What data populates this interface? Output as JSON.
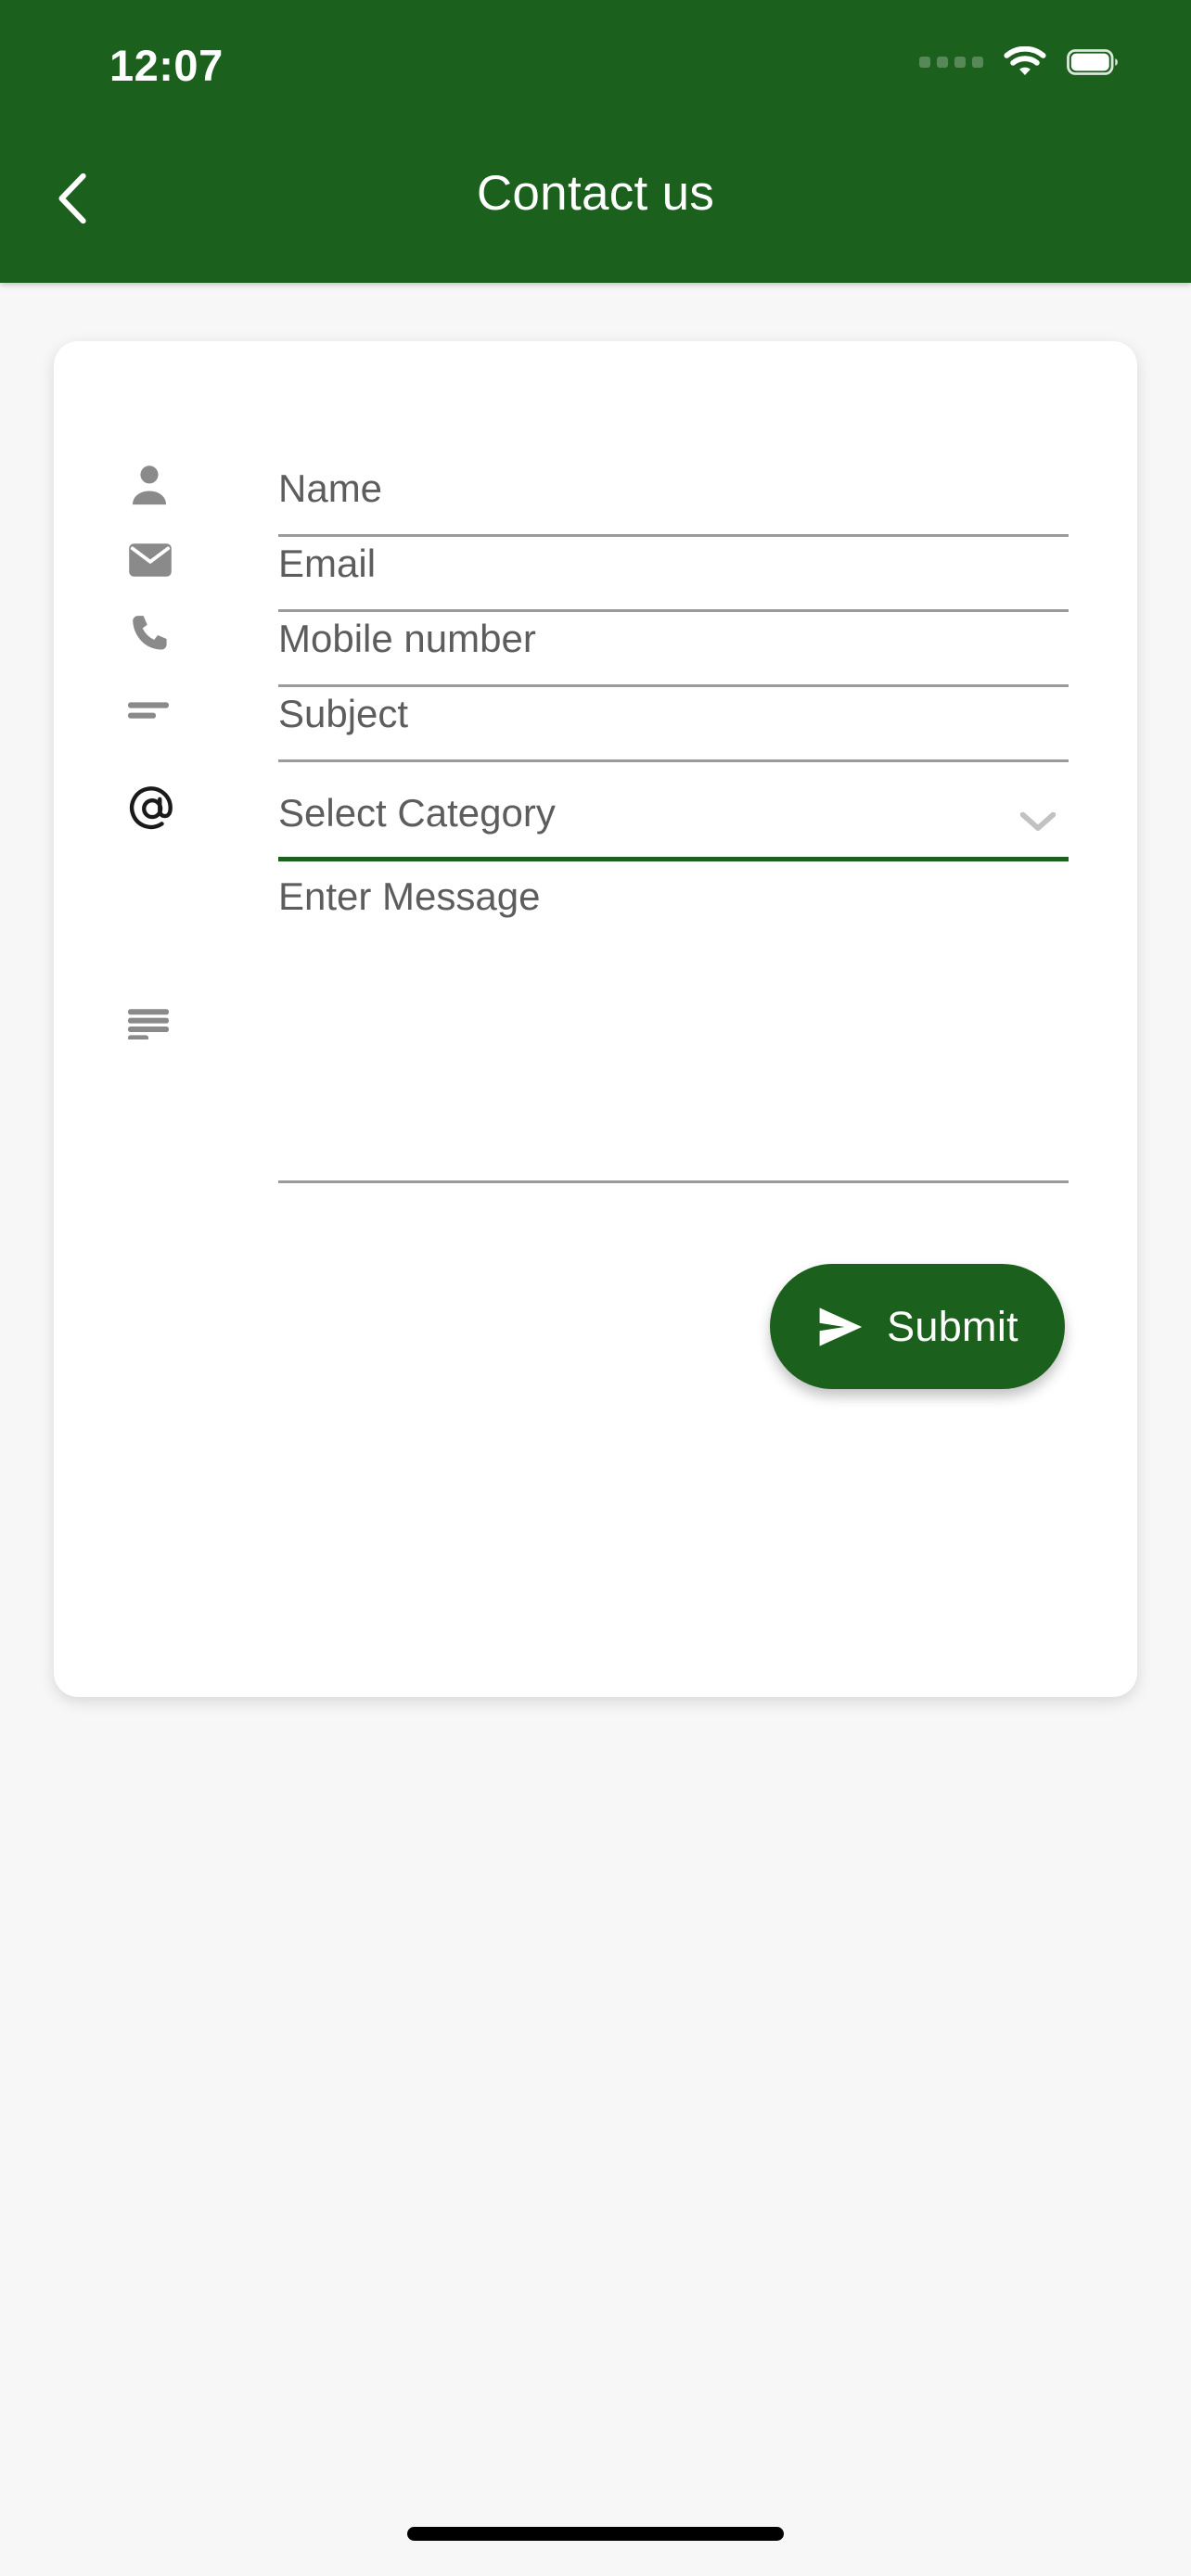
{
  "status_bar": {
    "time": "12:07",
    "cellular_icon": "cellular-dots-icon",
    "wifi_icon": "wifi-icon",
    "battery_icon": "battery-full-icon"
  },
  "header": {
    "title": "Contact us",
    "back_icon": "chevron-left-icon",
    "background_color": "#1b601d",
    "text_color": "#ffffff"
  },
  "form": {
    "fields": [
      {
        "key": "name",
        "icon": "person-icon",
        "placeholder": "Name",
        "value": "",
        "type": "text",
        "active": false
      },
      {
        "key": "email",
        "icon": "envelope-icon",
        "placeholder": "Email",
        "value": "",
        "type": "email",
        "active": false
      },
      {
        "key": "mobile",
        "icon": "phone-icon",
        "placeholder": "Mobile number",
        "value": "",
        "type": "tel",
        "active": false
      },
      {
        "key": "subject",
        "icon": "short-text-icon",
        "placeholder": "Subject",
        "value": "",
        "type": "text",
        "active": false
      },
      {
        "key": "category",
        "icon": "at-sign-icon",
        "placeholder": "Select Category",
        "value": "",
        "type": "select",
        "active": true,
        "dropdown_icon": "chevron-down-icon"
      },
      {
        "key": "message",
        "icon": "text-lines-icon",
        "placeholder": "Enter Message",
        "value": "",
        "type": "textarea",
        "active": false
      }
    ],
    "submit": {
      "label": "Submit",
      "icon": "send-icon",
      "color": "#1b601d",
      "text_color": "#ffffff"
    }
  },
  "colors": {
    "brand_green": "#1b601d",
    "page_background": "#f7f7f7",
    "card_background": "#ffffff",
    "placeholder_text": "#5d5d5d",
    "underline": "#9b9b9b",
    "icon_gray": "#8a8a8a",
    "icon_dark": "#1a1a1a"
  }
}
